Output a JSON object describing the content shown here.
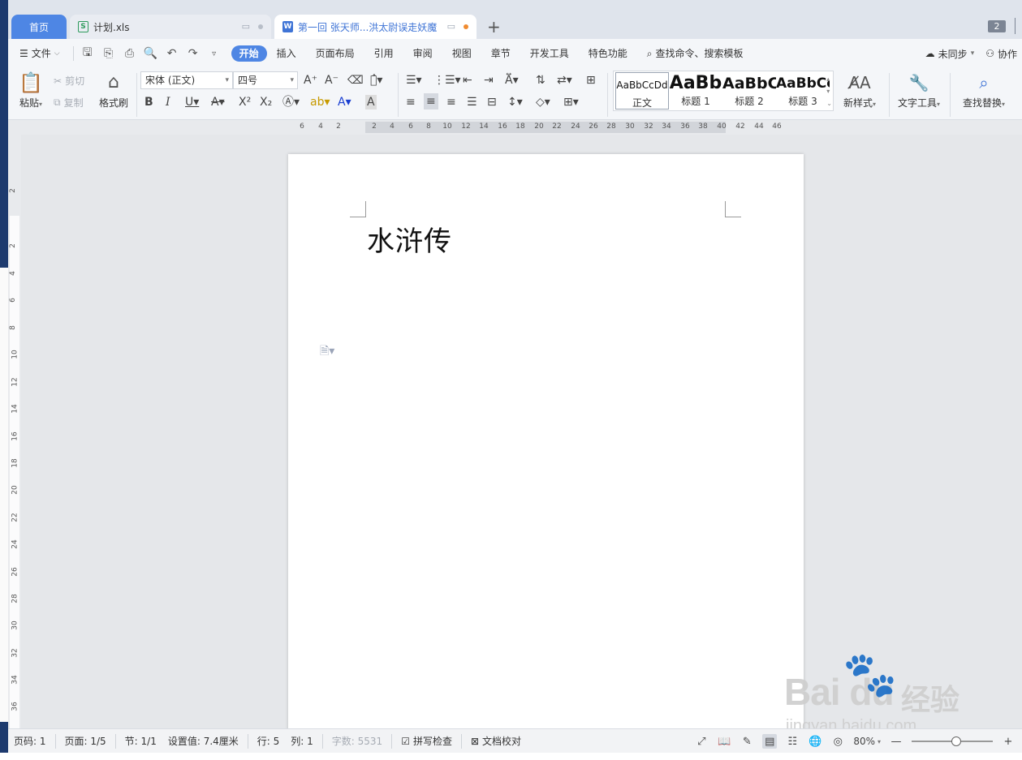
{
  "tabs": {
    "home": "首页",
    "xls": "计划.xls",
    "doc": "第一回 张天师...洪太尉误走妖魔",
    "add": "+",
    "window_count": "2"
  },
  "menu": {
    "file": "文件",
    "items": [
      "开始",
      "插入",
      "页面布局",
      "引用",
      "审阅",
      "视图",
      "章节",
      "开发工具",
      "特色功能"
    ],
    "search": "查找命令、搜索模板",
    "sync": "未同步",
    "collab": "协作"
  },
  "ribbon": {
    "paste": "粘贴",
    "cut": "剪切",
    "copy": "复制",
    "format_painter": "格式刷",
    "font_name": "宋体 (正文)",
    "font_size": "四号",
    "styles": [
      {
        "sample": "AaBbCcDd",
        "name": "正文"
      },
      {
        "sample": "AaBb",
        "name": "标题 1"
      },
      {
        "sample": "AaBbC",
        "name": "标题 2"
      },
      {
        "sample": "AaBbCc",
        "name": "标题 3"
      }
    ],
    "new_style": "新样式",
    "text_tools": "文字工具",
    "find_replace": "查找替换"
  },
  "ruler": {
    "h_ticks": [
      "6",
      "4",
      "2",
      "2",
      "4",
      "6",
      "8",
      "10",
      "12",
      "14",
      "16",
      "18",
      "20",
      "22",
      "24",
      "26",
      "28",
      "30",
      "32",
      "34",
      "36",
      "38",
      "40",
      "42",
      "44",
      "46"
    ],
    "v_ticks": [
      "2",
      "2",
      "4",
      "6",
      "8",
      "10",
      "12",
      "14",
      "16",
      "18",
      "20",
      "22",
      "24",
      "26",
      "28",
      "30",
      "32",
      "34",
      "36"
    ]
  },
  "document": {
    "title": "水浒传"
  },
  "status": {
    "page_num": "页码: 1",
    "pages": "页面: 1/5",
    "section": "节: 1/1",
    "setting": "设置值: 7.4厘米",
    "row": "行: 5",
    "col": "列: 1",
    "words": "字数: 5531",
    "spell": "拼写检查",
    "proof": "文档校对",
    "zoom": "80%",
    "zoom_level": 0.55
  },
  "watermark": {
    "logo": "Bai  du",
    "jy": "经验",
    "url": "jingyan.baidu.com"
  }
}
